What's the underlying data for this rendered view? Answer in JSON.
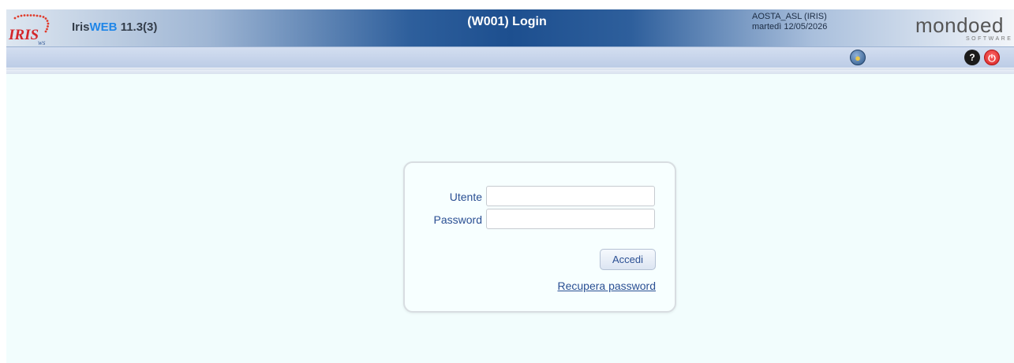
{
  "header": {
    "app_name_prefix": "Iris",
    "app_name_highlight": "WEB",
    "app_version": "11.3(3)",
    "page_title": "(W001) Login",
    "org_name": "AOSTA_ASL (IRIS)",
    "date": "martedì 12/05/2026",
    "logo_text": "IRIS",
    "brand_name": "mondoed",
    "brand_sub": "SOFTWARE"
  },
  "toolbar": {
    "user_icon": "user-info-icon",
    "help_icon": "help-icon",
    "help_glyph": "?",
    "power_icon": "logout-icon",
    "power_glyph": "⏻"
  },
  "login": {
    "user_label": "Utente",
    "user_value": "",
    "password_label": "Password",
    "password_value": "",
    "submit_label": "Accedi",
    "recover_label": "Recupera password"
  },
  "colors": {
    "header_dark": "#1d4f8f",
    "accent_blue": "#1f86e8",
    "label_blue": "#2a4f93",
    "page_bg": "#f2fdfd"
  }
}
